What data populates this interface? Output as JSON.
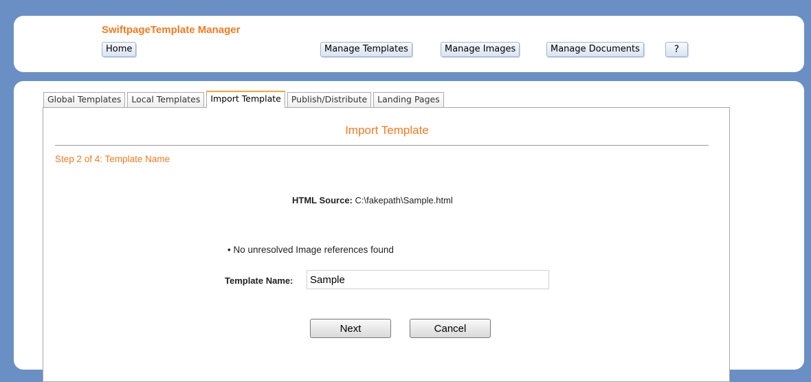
{
  "header": {
    "app_title": "SwiftpageTemplate Manager",
    "nav": {
      "home": "Home",
      "manage_templates": "Manage Templates",
      "manage_images": "Manage Images",
      "manage_documents": "Manage Documents",
      "help": "?"
    }
  },
  "tabs": [
    {
      "label": "Global Templates",
      "active": false
    },
    {
      "label": "Local Templates",
      "active": false
    },
    {
      "label": "Import Template",
      "active": true
    },
    {
      "label": "Publish/Distribute",
      "active": false
    },
    {
      "label": "Landing Pages",
      "active": false
    }
  ],
  "main": {
    "section_title": "Import Template",
    "step_label": "Step 2 of 4: Template Name",
    "html_source_label": "HTML Source:",
    "html_source_value": "C:\\fakepath\\Sample.html",
    "bullet_message": "No unresolved Image references found",
    "template_name_label": "Template Name:",
    "template_name_value": "Sample",
    "next_label": "Next",
    "cancel_label": "Cancel"
  },
  "colors": {
    "page_background": "#6a8fc5",
    "accent_orange": "#f47a20",
    "active_tab_border": "#f4a63a"
  }
}
